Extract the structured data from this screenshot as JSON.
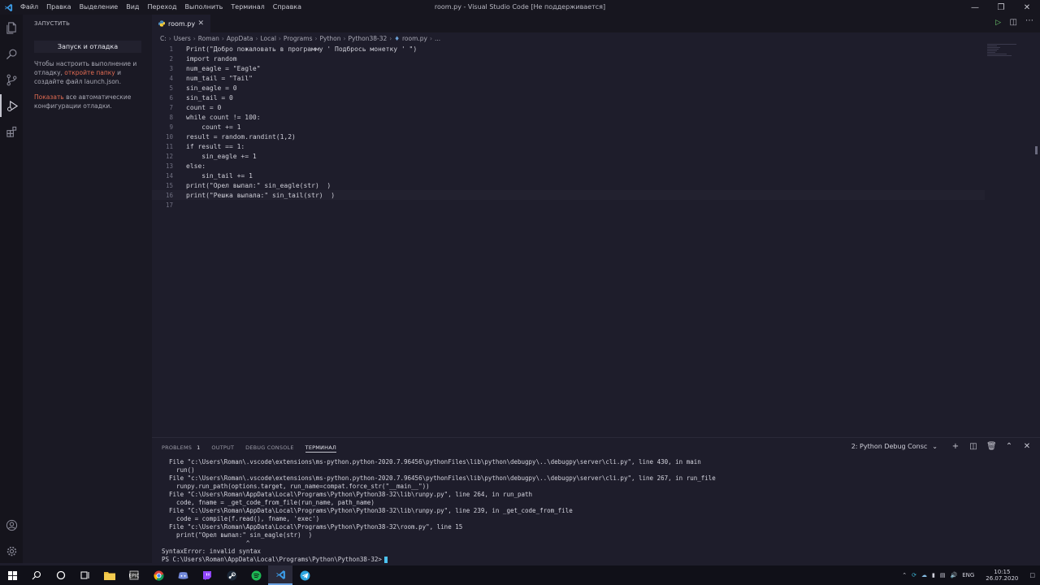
{
  "titlebar": {
    "menu": [
      "Файл",
      "Правка",
      "Выделение",
      "Вид",
      "Переход",
      "Выполнить",
      "Терминал",
      "Справка"
    ],
    "title": "room.py - Visual Studio Code [Не поддерживается]"
  },
  "sidebar": {
    "header": "ЗАПУСТИТЬ",
    "button": "Запуск и отладка",
    "text1_before": "Чтобы настроить выполнение и отладку, ",
    "text1_link": "откройте папку",
    "text1_after": " и создайте файл launch.json.",
    "text2_link": "Показать",
    "text2_after": " все автоматические конфигурации отладки."
  },
  "tab": {
    "label": "room.py"
  },
  "breadcrumb": [
    "C:",
    "Users",
    "Roman",
    "AppData",
    "Local",
    "Programs",
    "Python",
    "Python38-32",
    "room.py",
    "..."
  ],
  "editor": {
    "lines": [
      "Print(\"Добро пожаловать в программу ' Подбрось монетку ' \")",
      "import random",
      "num_eagle = \"Eagle\"",
      "num_tail = \"Tail\"",
      "sin_eagle = 0",
      "sin_tail = 0",
      "count = 0",
      "while count != 100:",
      "    count += 1",
      "result = random.randint(1,2)",
      "if result == 1:",
      "    sin_eagle += 1",
      "else:",
      "    sin_tail += 1",
      "print(\"Орел выпал:\" sin_eagle(str)  )",
      "print(\"Решка выпала:\" sin_tail(str)  )",
      ""
    ]
  },
  "panel": {
    "tabs": [
      "PROBLEMS",
      "OUTPUT",
      "DEBUG CONSOLE",
      "ТЕРМИНАЛ"
    ],
    "problems_count": "1",
    "terminal_select": "2: Python Debug Consc",
    "terminal_lines": [
      "  File \"c:\\Users\\Roman\\.vscode\\extensions\\ms-python.python-2020.7.96456\\pythonFiles\\lib\\python\\debugpy\\..\\debugpy\\server\\cli.py\", line 430, in main",
      "    run()",
      "  File \"c:\\Users\\Roman\\.vscode\\extensions\\ms-python.python-2020.7.96456\\pythonFiles\\lib\\python\\debugpy\\..\\debugpy\\server\\cli.py\", line 267, in run_file",
      "    runpy.run_path(options.target, run_name=compat.force_str(\"__main__\"))",
      "  File \"C:\\Users\\Roman\\AppData\\Local\\Programs\\Python\\Python38-32\\lib\\runpy.py\", line 264, in run_path",
      "    code, fname = _get_code_from_file(run_name, path_name)",
      "  File \"C:\\Users\\Roman\\AppData\\Local\\Programs\\Python\\Python38-32\\lib\\runpy.py\", line 239, in _get_code_from_file",
      "    code = compile(f.read(), fname, 'exec')",
      "  File \"c:\\Users\\Roman\\AppData\\Local\\Programs\\Python\\Python38-32\\room.py\", line 15",
      "    print(\"Орел выпал:\" sin_eagle(str)  )",
      "                       ^",
      "SyntaxError: invalid syntax"
    ],
    "prompt": "PS C:\\Users\\Roman\\AppData\\Local\\Programs\\Python\\Python38-32>"
  },
  "taskbar": {
    "lang": "ENG",
    "time": "10:15",
    "date": "26.07.2020"
  }
}
